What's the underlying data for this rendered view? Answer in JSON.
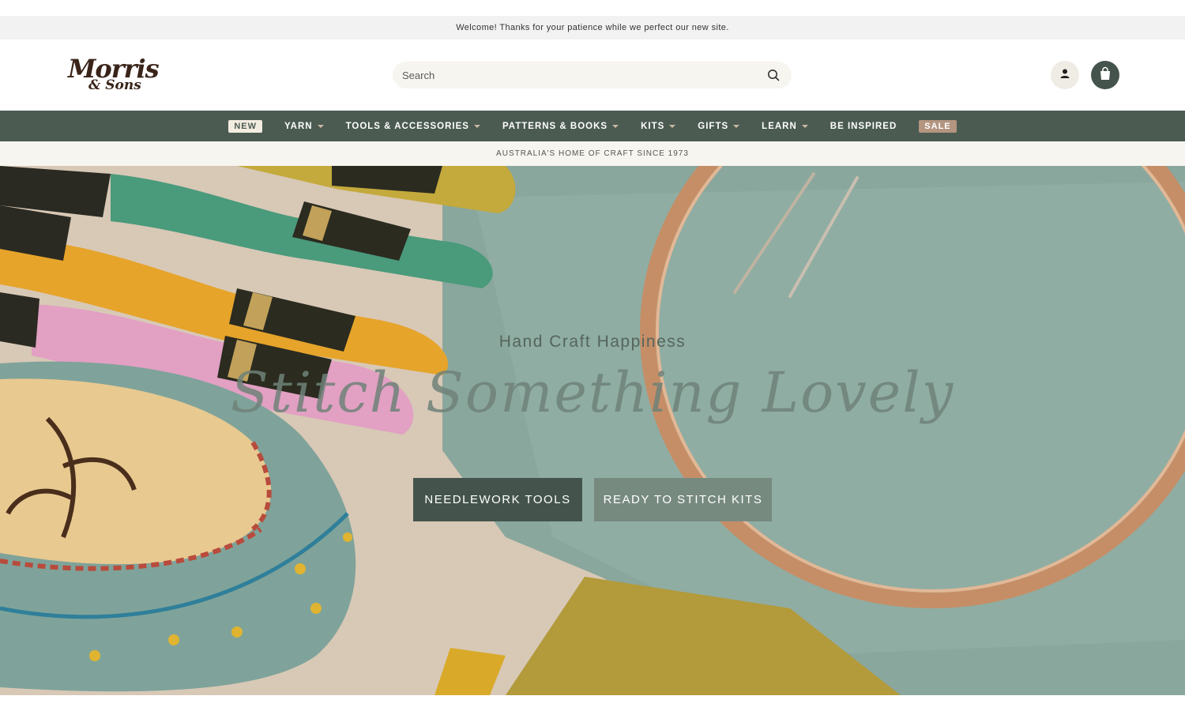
{
  "announcement": "Welcome! Thanks for your patience while we perfect our new site.",
  "brand": {
    "logo_line1": "Morris",
    "logo_line2": "& Sons"
  },
  "search": {
    "placeholder": "Search",
    "icon": "search-icon"
  },
  "header_icons": {
    "account": "account-icon",
    "cart": "shopping-bag-icon"
  },
  "nav": {
    "items": [
      {
        "label": "NEW",
        "badge": "new",
        "dropdown": false
      },
      {
        "label": "YARN",
        "dropdown": true
      },
      {
        "label": "TOOLS & ACCESSORIES",
        "dropdown": true
      },
      {
        "label": "PATTERNS & BOOKS",
        "dropdown": true
      },
      {
        "label": "KITS",
        "dropdown": true
      },
      {
        "label": "GIFTS",
        "dropdown": true
      },
      {
        "label": "LEARN",
        "dropdown": true
      },
      {
        "label": "BE INSPIRED",
        "dropdown": false
      },
      {
        "label": "SALE",
        "badge": "sale",
        "dropdown": false
      }
    ]
  },
  "tagline": "AUSTRALIA'S HOME OF CRAFT SINCE 1973",
  "hero": {
    "eyebrow": "Hand Craft Happiness",
    "headline": "Stitch Something Lovely",
    "buttons": [
      {
        "label": "NEEDLEWORK TOOLS"
      },
      {
        "label": "READY TO STITCH KITS"
      }
    ]
  },
  "colors": {
    "nav_bg": "#4b5b52",
    "primary_button": "#44544c",
    "secondary_button": "#778a80",
    "sale_badge": "#b39580",
    "announcement_bg": "#f2f2f2"
  }
}
